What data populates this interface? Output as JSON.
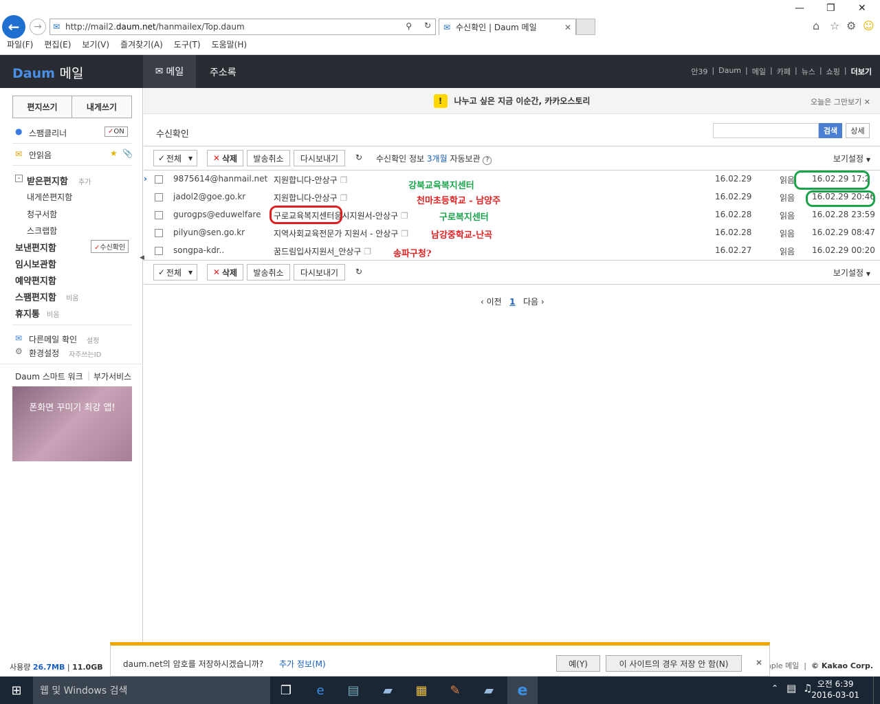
{
  "browser": {
    "url_prefix": "http://mail2.",
    "url_domain": "daum.net",
    "url_suffix": "/hanmailex/Top.daum",
    "tab_title": "수신확인 | Daum 메일",
    "menu": [
      "파일(F)",
      "편집(E)",
      "보기(V)",
      "즐겨찾기(A)",
      "도구(T)",
      "도움말(H)"
    ]
  },
  "header": {
    "logo_text": "Daum",
    "logo_service": "메일",
    "tab_mail": "메일",
    "tab_addressbook": "주소록",
    "user": "안39",
    "links": [
      "Daum",
      "메일",
      "카페",
      "뉴스",
      "쇼핑"
    ],
    "more": "더보기"
  },
  "sidebar": {
    "compose": "편지쓰기",
    "to_me": "내게쓰기",
    "spam_cleaner": "스팸클리너",
    "spam_on": "ON",
    "unread": "안읽음",
    "inbox": "받은편지함",
    "inbox_add": "추가",
    "self_box": "내게쓴편지함",
    "invoice_box": "청구서함",
    "scrap_box": "스크랩함",
    "sent_box": "보낸편지함",
    "read_confirm": "수신확인",
    "drafts": "임시보관함",
    "reserved": "예약편지함",
    "spam_box": "스팸편지함",
    "spam_empty": "비움",
    "trash": "휴지통",
    "trash_empty": "비움",
    "other_mail": "다른메일 확인",
    "other_mail_setting": "설정",
    "settings": "환경설정",
    "settings_sub": "자주쓰는ID",
    "smartwork": "Daum 스마트 워크",
    "extra": "부가서비스",
    "promo_text": "폰화면 꾸미기 최강 앱!"
  },
  "banner": {
    "text": "나누고 싶은 지금 이순간, 카카오스토리",
    "close": "오늘은 그만보기"
  },
  "page": {
    "title": "수신확인",
    "search_btn": "검색",
    "detail_btn": "상세"
  },
  "toolbar": {
    "select_all": "전체",
    "delete": "삭제",
    "cancel_send": "발송취소",
    "resend": "다시보내기",
    "info_label": "수신확인 정보",
    "info_months": "3개월",
    "info_suffix": "자동보관",
    "view_settings": "보기설정"
  },
  "rows": [
    {
      "from": "9875614@hanmail.net",
      "subject": "지원합니다-안상구",
      "sent": "16.02.29",
      "status": "읽음",
      "read_time": "16.02.29 17:2"
    },
    {
      "from": "jadol2@goe.go.kr",
      "subject": "지원합니다-안상구",
      "sent": "16.02.29",
      "status": "읽음",
      "read_time": "16.02.29 20:46"
    },
    {
      "from": "gurogps@eduwelfare",
      "subject": "구로교육복지센터",
      "subject_rest": "응시지원서-안상구",
      "sent": "16.02.28",
      "status": "읽음",
      "read_time": "16.02.28 23:59"
    },
    {
      "from": "pilyun@sen.go.kr",
      "subject": "지역사회교육전문가 지원서 - 안상구",
      "sent": "16.02.28",
      "status": "읽음",
      "read_time": "16.02.29 08:47"
    },
    {
      "from": "songpa-kdr..",
      "subject": "꿈드림입사지원서_안상구",
      "sent": "16.02.27",
      "status": "읽음",
      "read_time": "16.02.29 00:20"
    }
  ],
  "annotations": [
    {
      "text": "강북교육복지센터",
      "color": "#1aa34a"
    },
    {
      "text": "천마초등학교 - 남양주",
      "color": "#e02020"
    },
    {
      "text": "구로복지센터",
      "color": "#1aa34a"
    },
    {
      "text": "남강중학교-난곡",
      "color": "#e02020"
    },
    {
      "text": "송파구청?",
      "color": "#e02020"
    }
  ],
  "pager": {
    "prev": "이전",
    "current": "1",
    "next": "다음"
  },
  "footer": {
    "usage_label": "사용량",
    "used": "26.7MB",
    "total": "11.0GB",
    "simple": "Simple 메일",
    "copyright": "© Kakao Corp."
  },
  "password_bar": {
    "question": "daum.net의 암호를 저장하시겠습니까?",
    "more_info": "추가 정보(M)",
    "yes": "예(Y)",
    "never": "이 사이트의 경우 저장 안 함(N)"
  },
  "taskbar": {
    "search_placeholder": "웹 및 Windows 검색",
    "time": "오전 6:39",
    "date": "2016-03-01"
  }
}
